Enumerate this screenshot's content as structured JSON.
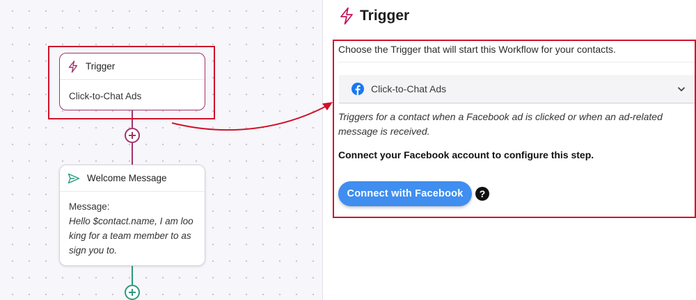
{
  "canvas": {
    "trigger_node": {
      "title": "Trigger",
      "subtitle": "Click-to-Chat Ads",
      "icon": "lightning-icon"
    },
    "welcome_node": {
      "title": "Welcome Message",
      "icon": "send-icon",
      "message_label": "Message:",
      "message_line_1": "Hello $contact.name, I am loo",
      "message_line_2": "king for a team member to as",
      "message_line_3": "sign you to."
    }
  },
  "panel": {
    "title": "Trigger",
    "icon": "lightning-icon",
    "description": "Choose the Trigger that will start this Workflow for your contacts.",
    "trigger_select": {
      "value": "Click-to-Chat Ads",
      "icon": "facebook-icon"
    },
    "help_line_1": "Triggers for a contact when a Facebook ad is clicked or when an ad-related",
    "help_line_2": "message is received.",
    "connect_note": "Connect your Facebook account to configure this step.",
    "connect_button": "Connect with Facebook",
    "help_icon_symbol": "?"
  },
  "colors": {
    "accent": "#a0336a",
    "highlight": "#d0112b",
    "button": "#3f8ef0",
    "welcome_connector": "#2a9a7c"
  }
}
